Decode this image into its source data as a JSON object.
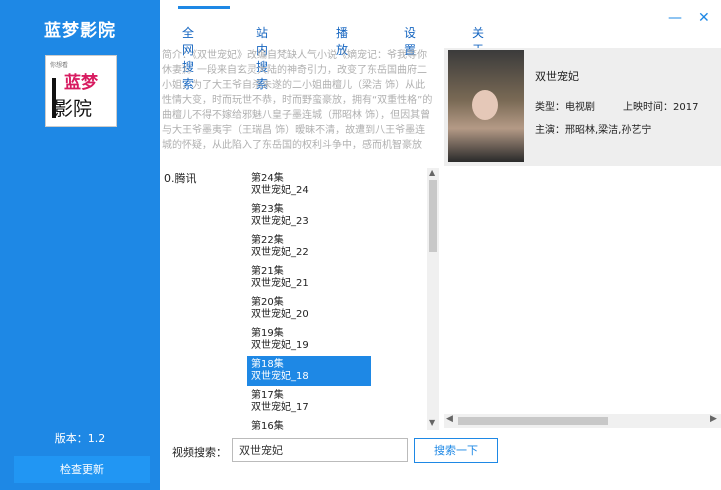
{
  "app": {
    "title": "蓝梦影院",
    "version": "版本：1.2",
    "update_button": "检查更新",
    "logo_text_small": "你想看",
    "logo_text_top": "蓝梦",
    "logo_text_bottom": "影院"
  },
  "tabs": [
    "全网搜索",
    "站内搜索",
    "播放",
    "设置",
    "关于"
  ],
  "window_controls": {
    "minimize": "—",
    "close": "✕"
  },
  "description": "简介：《双世宠妃》改编自梵缺人气小说《嫡宠记：爷我等你休妻》。一段来自玄灵大陆的神奇引力，改变了东岳国曲府二小姐，为了大王爷自杀未遂的二小姐曲檀儿（梁洁 饰）从此性情大变，时而玩世不恭，时而野蛮豪放，拥有“双重性格”的曲檀儿不得不嫁给邪魅八皇子墨连城（邢昭林 饰），但因其曾与大王爷墨夷宇（王瑞昌 饰）暧昧不清，故遭到八王爷墨连城的怀疑，从此陷入了东岳国的权利斗争中，感而机智豪放",
  "detail": {
    "title": "双世宠妃",
    "type_label": "类型：电视剧",
    "release_label": "上映时间：2017",
    "cast_label": "主演：邢昭林,梁洁,孙艺宁"
  },
  "source": "0.腾讯",
  "episodes": [
    {
      "ep": "第24集",
      "name": "双世宠妃_24"
    },
    {
      "ep": "第23集",
      "name": "双世宠妃_23"
    },
    {
      "ep": "第22集",
      "name": "双世宠妃_22"
    },
    {
      "ep": "第21集",
      "name": "双世宠妃_21"
    },
    {
      "ep": "第20集",
      "name": "双世宠妃_20"
    },
    {
      "ep": "第19集",
      "name": "双世宠妃_19"
    },
    {
      "ep": "第18集",
      "name": "双世宠妃_18"
    },
    {
      "ep": "第17集",
      "name": "双世宠妃_17"
    },
    {
      "ep": "第16集",
      "name": ""
    }
  ],
  "selected_episode": "第18集",
  "search": {
    "label": "视频搜索：",
    "value": "双世宠妃",
    "button": "搜索一下"
  }
}
